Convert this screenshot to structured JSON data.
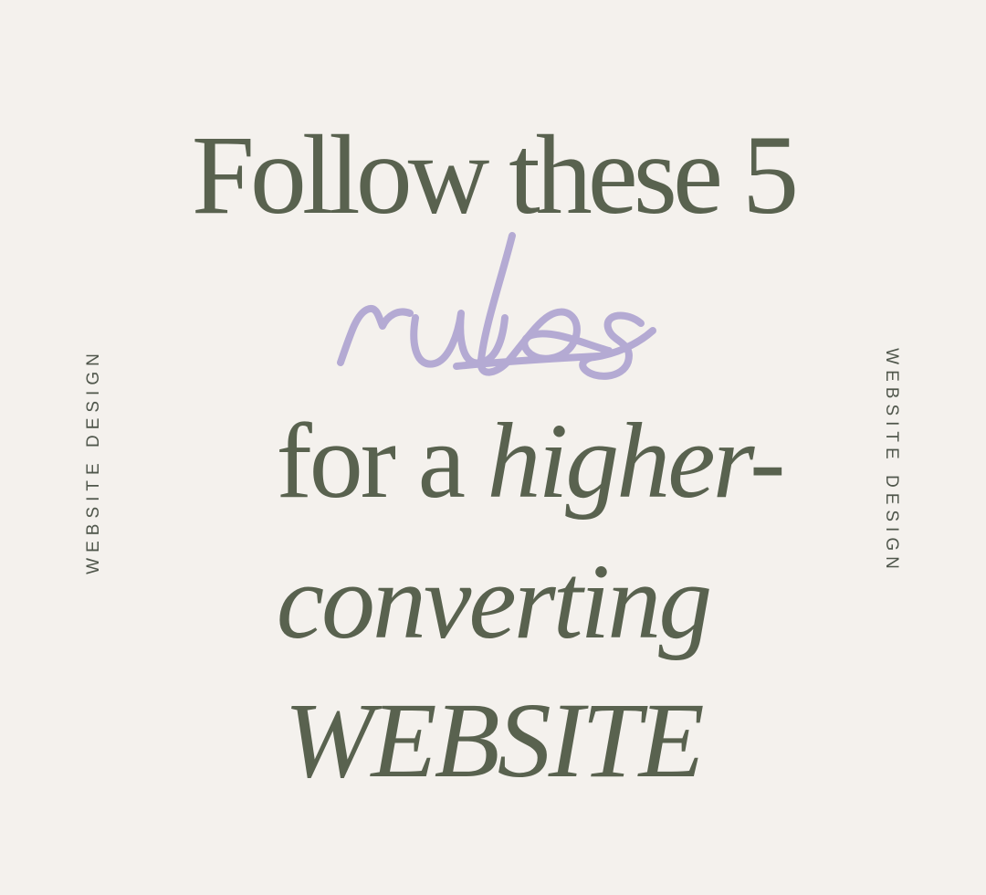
{
  "side_labels": {
    "left": "WEBSITE DESIGN",
    "right": "WEBSITE DESIGN"
  },
  "headline": {
    "line1": "Follow these 5",
    "script_word": "rules",
    "line3_regular": "for a ",
    "line3_italic": "higher-",
    "line4": "converting",
    "line5": "WEBSITE"
  },
  "colors": {
    "background": "#f4f1ed",
    "text": "#59624f",
    "script": "#b4aad3"
  }
}
